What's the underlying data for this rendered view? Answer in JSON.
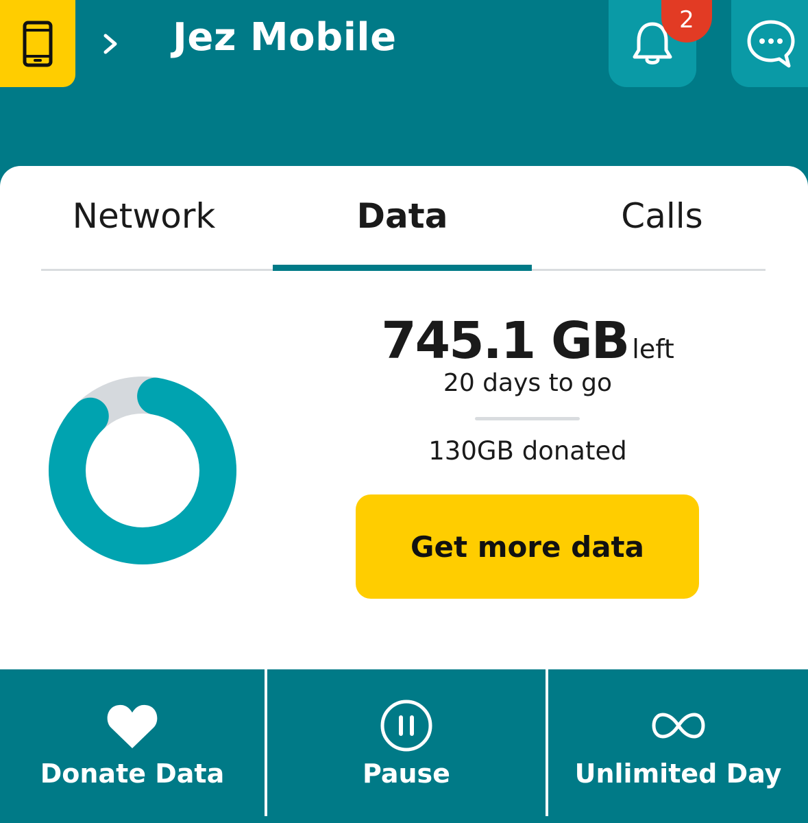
{
  "header": {
    "account_name": "Jez Mobile",
    "notification_count": "2",
    "icons": {
      "device": "phone-icon",
      "chevron": "chevron-right-icon",
      "bell": "bell-icon",
      "chat": "chat-bubble-icon"
    }
  },
  "tabs": [
    {
      "label": "Network",
      "selected": false
    },
    {
      "label": "Data",
      "selected": true
    },
    {
      "label": "Calls",
      "selected": false
    }
  ],
  "usage": {
    "amount": "745.1 GB",
    "amount_suffix": "left",
    "days_left": "20 days to go",
    "donated": "130GB donated",
    "remaining_fraction": 0.85
  },
  "cta": {
    "label": "Get more data"
  },
  "actions": [
    {
      "label": "Donate Data",
      "icon": "heart-icon"
    },
    {
      "label": "Pause",
      "icon": "pause-icon"
    },
    {
      "label": "Unlimited Day",
      "icon": "infinity-icon"
    }
  ],
  "colors": {
    "primary_teal": "#007A87",
    "light_teal": "#0A9AA6",
    "ring": "#00A3B0",
    "ring_track": "#D5D9DD",
    "accent_yellow": "#FFCD00",
    "badge_red": "#E23B24"
  }
}
